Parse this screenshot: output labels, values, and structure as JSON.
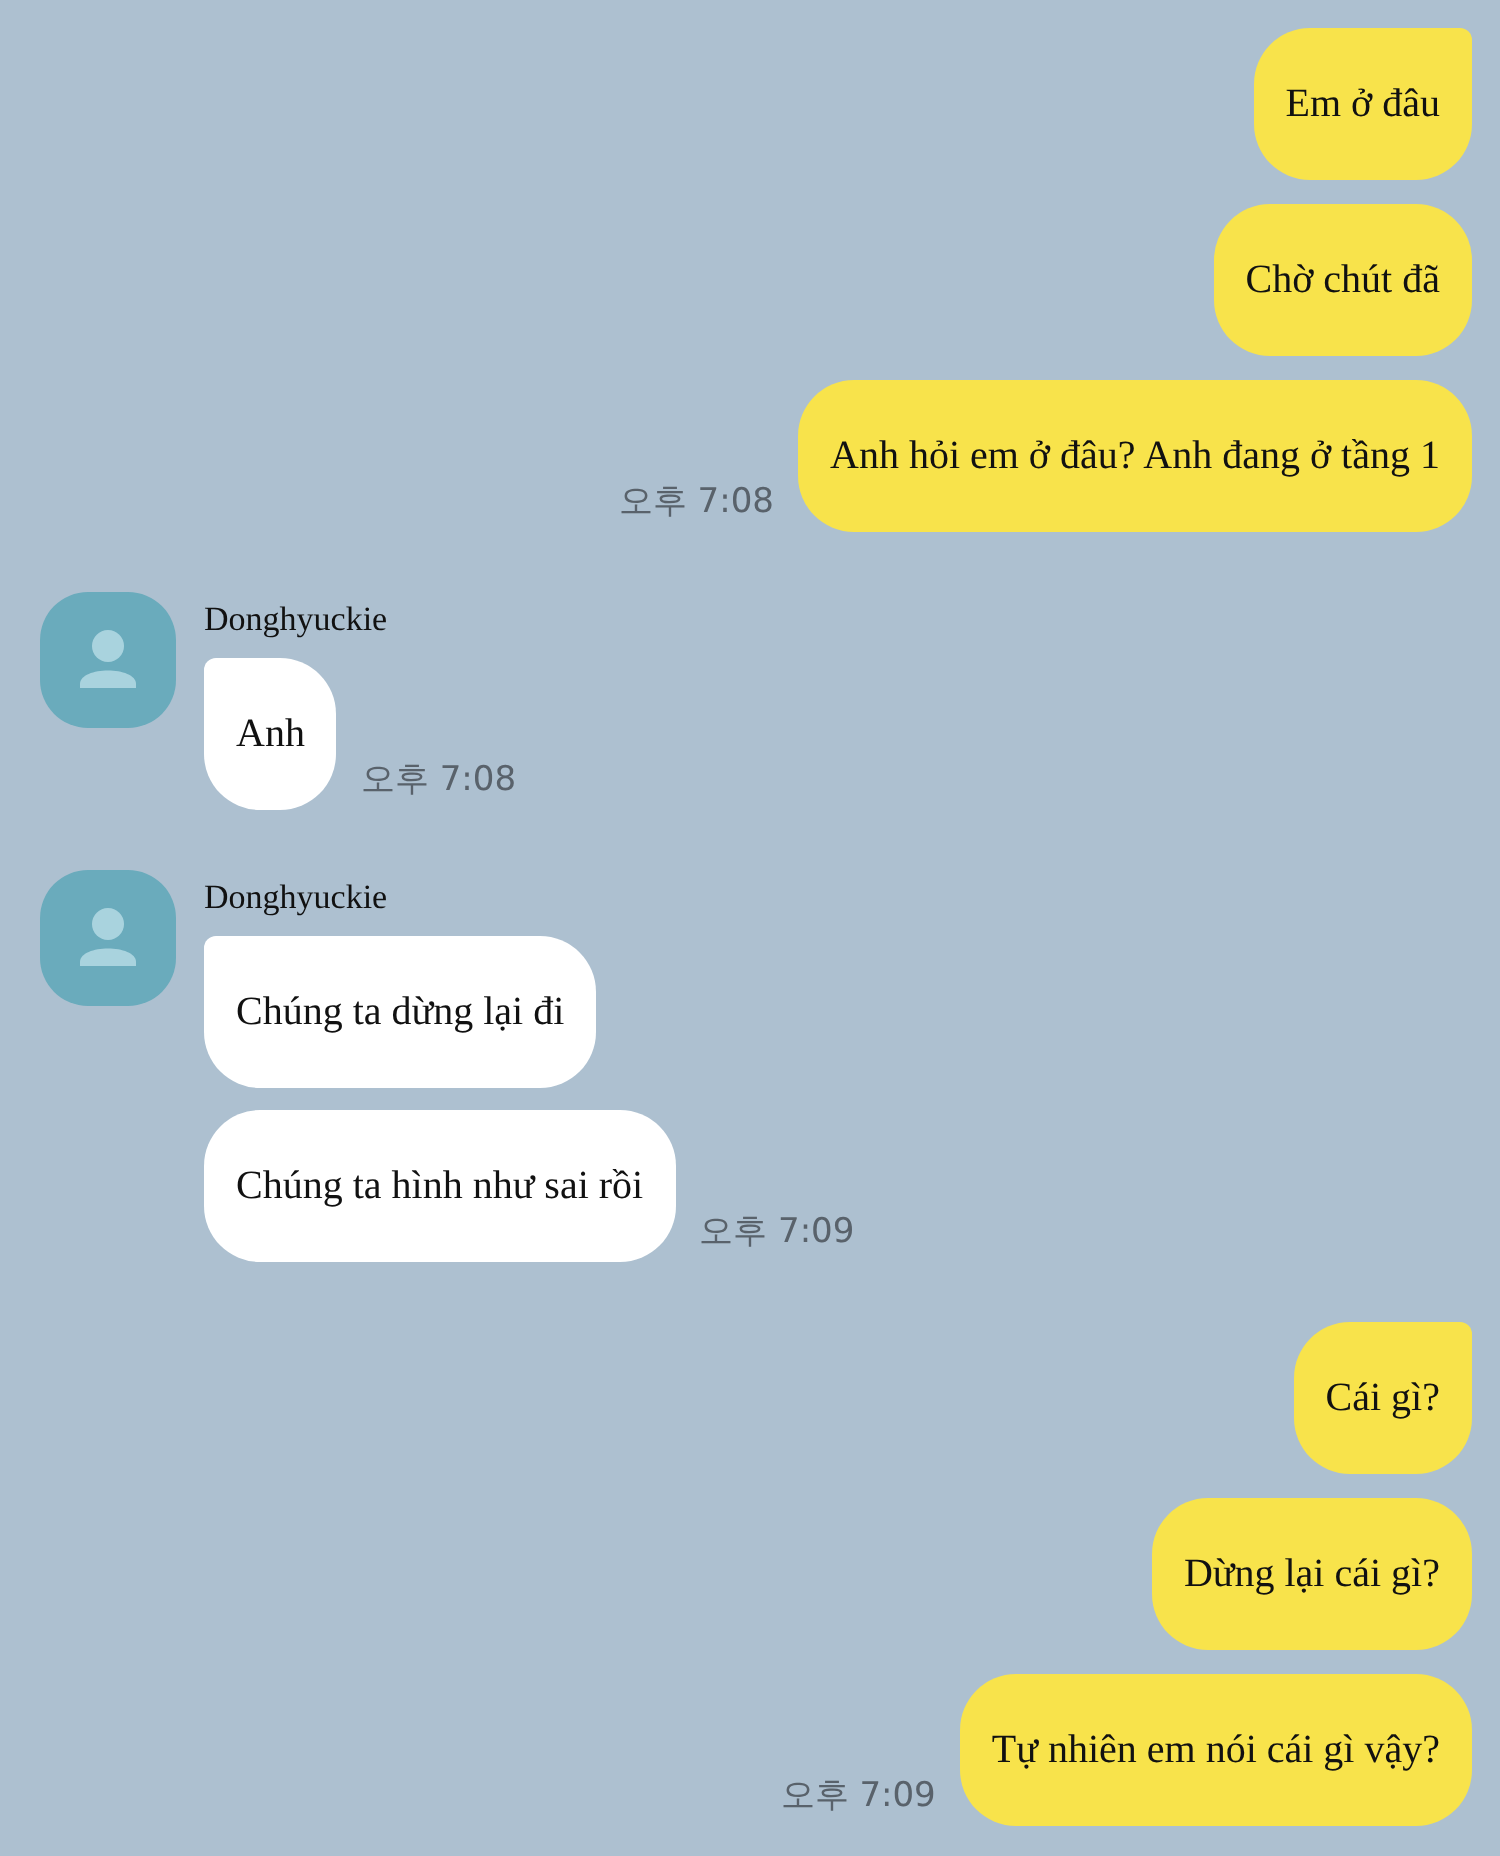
{
  "groups": [
    {
      "kind": "sent",
      "messages": [
        "Em ở đâu",
        "Chờ chút đã",
        "Anh hỏi em ở đâu? Anh đang ở tầng 1"
      ],
      "time": "오후 7:08"
    },
    {
      "kind": "received",
      "sender": "Donghyuckie",
      "messages": [
        "Anh"
      ],
      "time": "오후 7:08"
    },
    {
      "kind": "received",
      "sender": "Donghyuckie",
      "messages": [
        "Chúng ta dừng lại đi",
        "Chúng ta hình như sai rồi"
      ],
      "time": "오후 7:09"
    },
    {
      "kind": "sent",
      "messages": [
        "Cái gì?",
        "Dừng lại cái gì?",
        "Tự nhiên em nói cái gì vậy?"
      ],
      "time": "오후 7:09"
    }
  ]
}
